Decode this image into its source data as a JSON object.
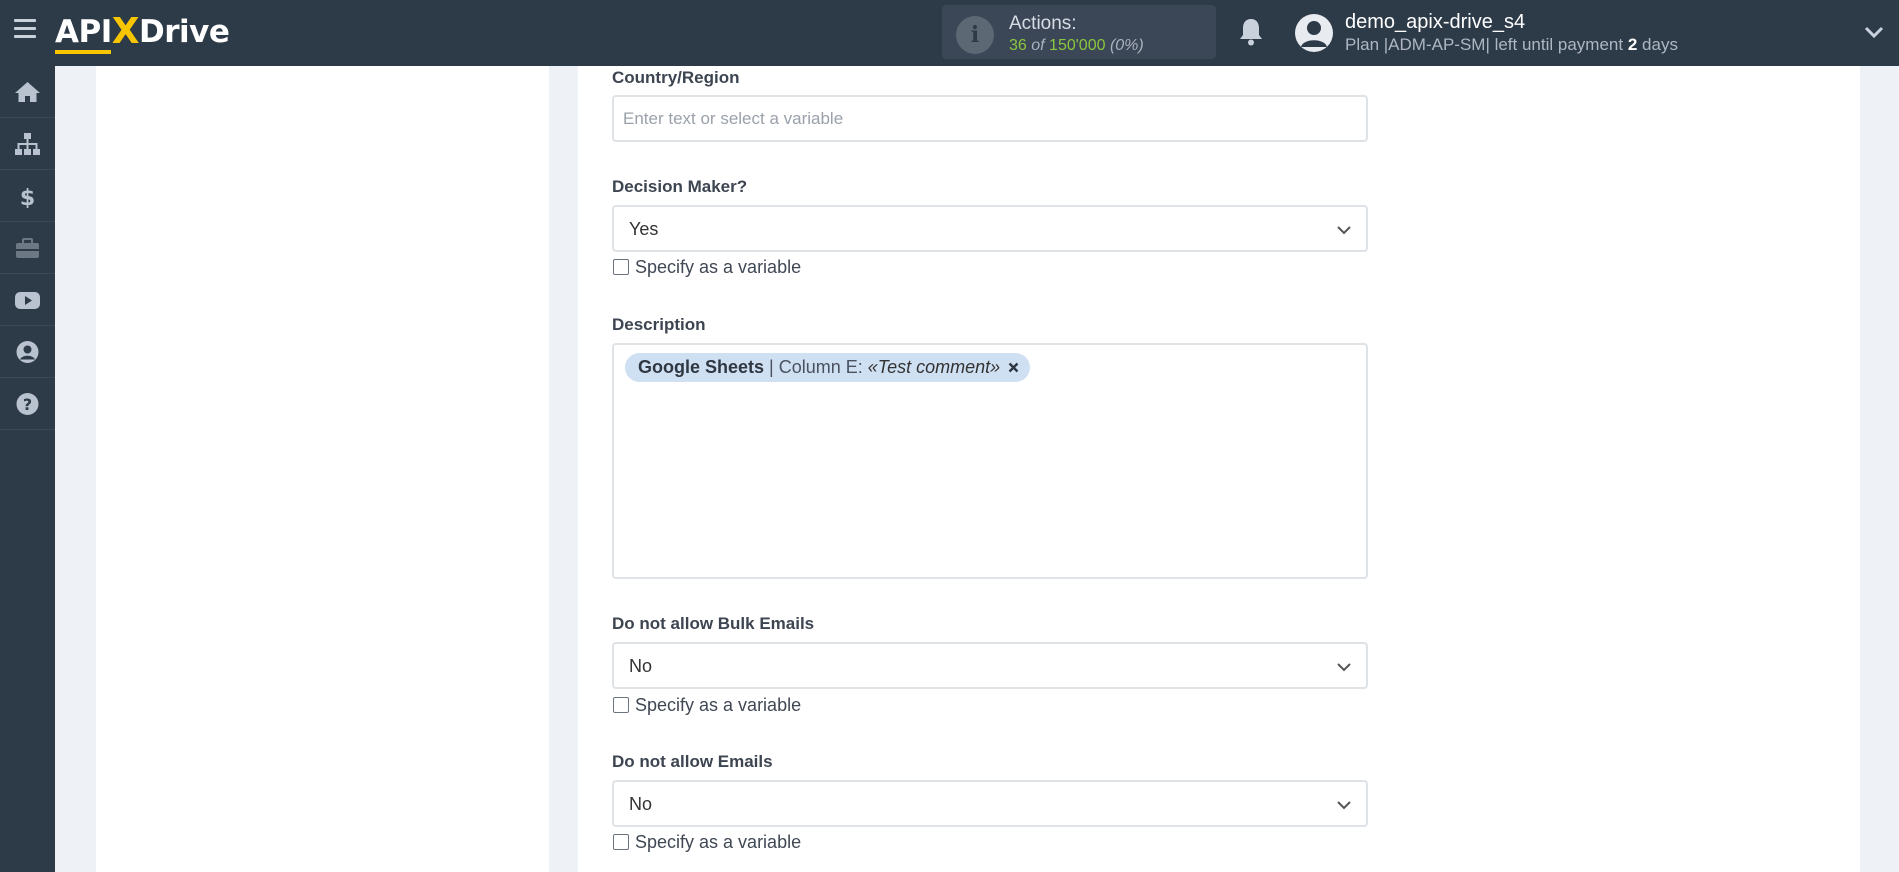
{
  "header": {
    "logo": {
      "api": "API",
      "x": "X",
      "drive": "Drive"
    },
    "actions": {
      "title": "Actions:",
      "used": "36",
      "of": "of",
      "total": "150'000",
      "percent": "(0%)"
    },
    "user": {
      "name": "demo_apix-drive_s4",
      "plan_prefix": "Plan |ADM-AP-SM| left until payment",
      "days_value": "2",
      "days_suffix": "days"
    }
  },
  "sidebar": {
    "items": [
      {
        "icon": "home-icon"
      },
      {
        "icon": "sitemap-icon"
      },
      {
        "icon": "dollar-icon"
      },
      {
        "icon": "briefcase-icon"
      },
      {
        "icon": "youtube-icon"
      },
      {
        "icon": "user-circle-icon"
      },
      {
        "icon": "question-circle-icon"
      }
    ]
  },
  "form": {
    "country": {
      "label": "Country/Region",
      "placeholder": "Enter text or select a variable",
      "value": ""
    },
    "decision_maker": {
      "label": "Decision Maker?",
      "value": "Yes",
      "checkbox": "Specify as a variable"
    },
    "description": {
      "label": "Description",
      "tag": {
        "source": "Google Sheets",
        "sep": " | Column E: ",
        "value": "«Test comment»"
      }
    },
    "bulk_emails": {
      "label": "Do not allow Bulk Emails",
      "value": "No",
      "checkbox": "Specify as a variable"
    },
    "emails": {
      "label": "Do not allow Emails",
      "value": "No",
      "checkbox": "Specify as a variable"
    }
  },
  "colors": {
    "topbar": "#2d3a48",
    "accent": "#f7c600",
    "actions_green": "#8cc63f",
    "tag_bg": "#cfe0f3"
  }
}
